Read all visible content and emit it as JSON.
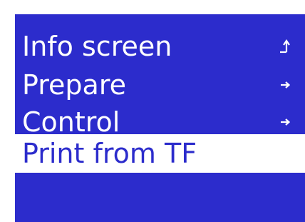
{
  "menu": {
    "items": [
      {
        "label": "Info screen",
        "icon": "return-icon",
        "selected": false
      },
      {
        "label": "Prepare",
        "icon": "arrow-right-icon",
        "selected": false
      },
      {
        "label": "Control",
        "icon": "arrow-right-icon",
        "selected": false
      },
      {
        "label": "Print from TF",
        "icon": "",
        "selected": true
      }
    ]
  },
  "colors": {
    "background": "#2c2ccc",
    "text": "#ffffff",
    "selected_background": "#ffffff",
    "selected_text": "#2c2ccc"
  }
}
